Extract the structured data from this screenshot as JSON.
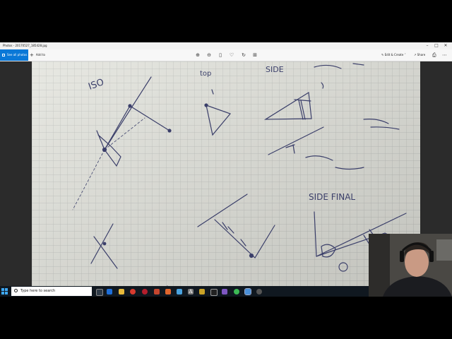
{
  "window": {
    "title": "Photos - 20170527_185428.jpg",
    "minimize_icon": "minimize-icon",
    "maximize_icon": "maximize-icon",
    "close_icon": "close-icon"
  },
  "toolbar": {
    "see_all_label": "See all photos",
    "add_to_label": "Add to",
    "edit_create_label": "Edit & Create",
    "share_label": "Share",
    "tools": [
      "zoom-in-icon",
      "zoom-out-icon",
      "delete-icon",
      "favorite-icon",
      "rotate-icon",
      "crop-icon"
    ]
  },
  "sketch": {
    "labels": [
      "ISO",
      "top",
      "SIDE",
      "SIDE FINAL"
    ]
  },
  "taskbar": {
    "search_placeholder": "Type here to search",
    "accent_color": "#0a78d7"
  }
}
